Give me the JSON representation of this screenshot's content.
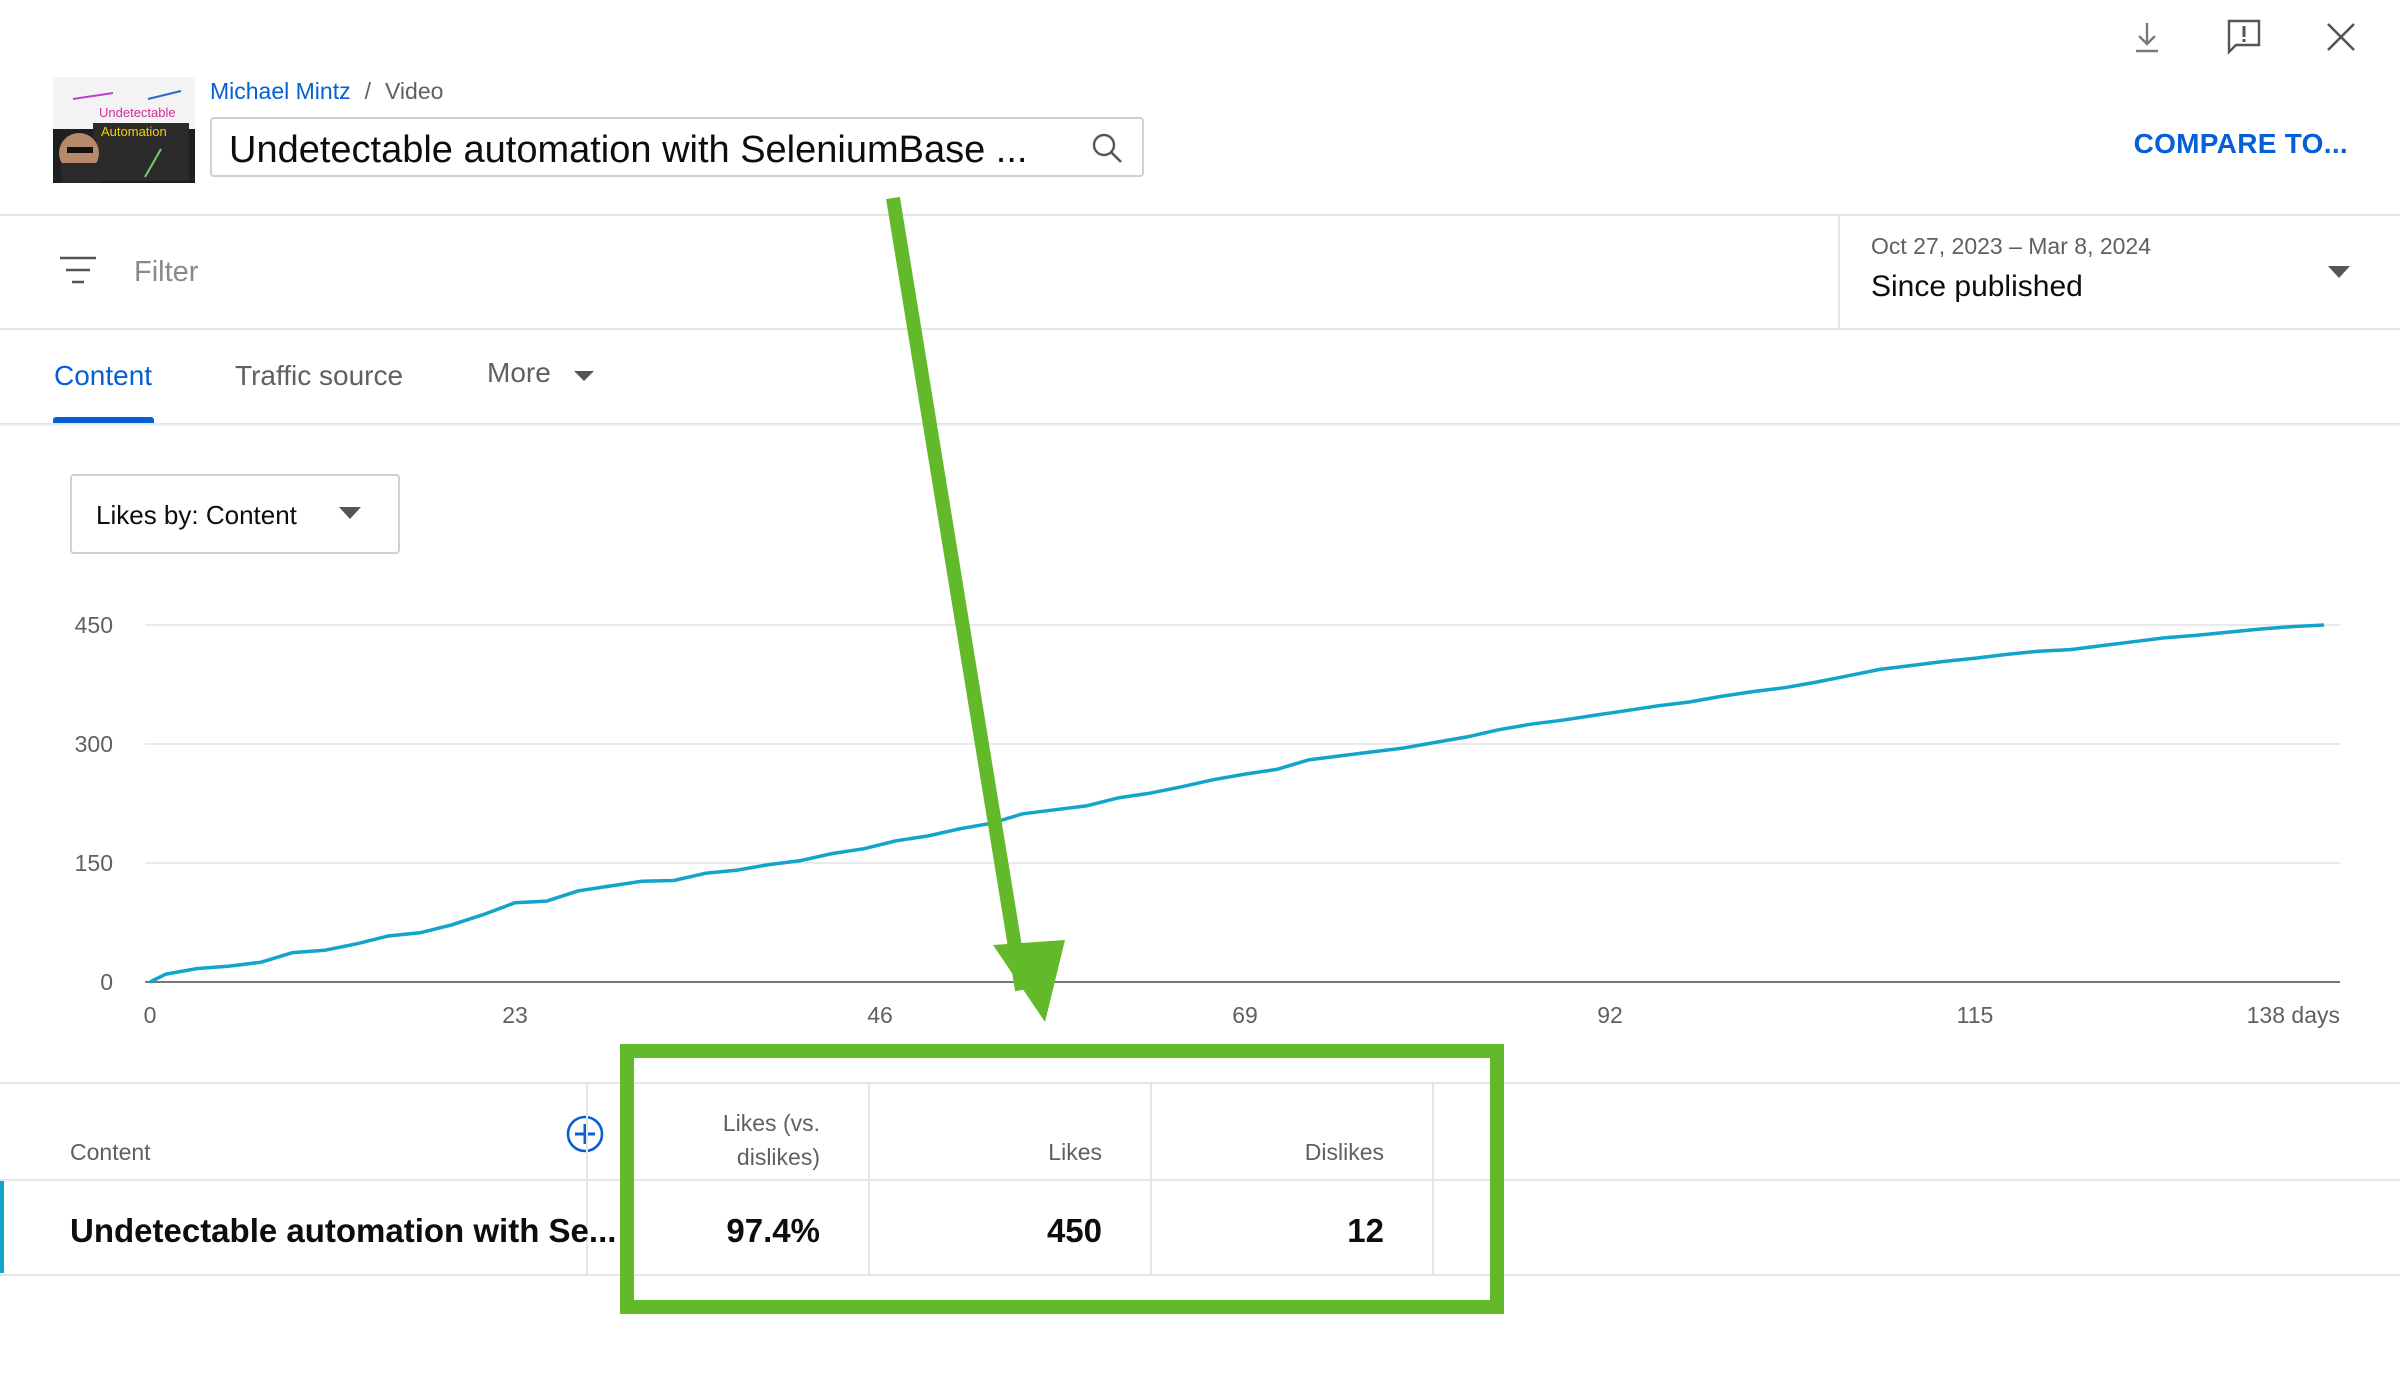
{
  "header": {
    "channel": "Michael Mintz",
    "separator": "/",
    "crumb_type": "Video",
    "title": "Undetectable automation with SeleniumBase ...",
    "compare_label": "COMPARE TO...",
    "thumbnail_text": "Undetectable Automation"
  },
  "toolbar": {
    "download_icon": "download-icon",
    "feedback_icon": "feedback-icon",
    "close_icon": "close-icon"
  },
  "filter": {
    "label": "Filter",
    "date_range": "Oct 27, 2023 – Mar 8, 2024",
    "period": "Since published"
  },
  "tabs": [
    {
      "label": "Content",
      "active": true
    },
    {
      "label": "Traffic source",
      "active": false
    },
    {
      "label": "More",
      "active": false
    }
  ],
  "metric_selector": {
    "label": "Likes by: Content"
  },
  "chart_data": {
    "type": "line",
    "title": "",
    "xlabel": "",
    "ylabel": "",
    "x_ticks": [
      "0",
      "23",
      "46",
      "69",
      "92",
      "115",
      "138 days"
    ],
    "y_ticks": [
      "0",
      "150",
      "300",
      "450"
    ],
    "xlim": [
      0,
      138
    ],
    "ylim": [
      0,
      450
    ],
    "grid": true,
    "series": [
      {
        "color": "#12a4c9",
        "x": [
          0,
          1,
          3,
          5,
          7,
          9,
          11,
          13,
          15,
          17,
          19,
          21,
          23,
          25,
          27,
          29,
          31,
          33,
          35,
          37,
          39,
          41,
          43,
          45,
          47,
          49,
          51,
          53,
          55,
          57,
          59,
          61,
          63,
          65,
          67,
          69,
          71,
          73,
          75,
          77,
          79,
          81,
          83,
          85,
          87,
          89,
          91,
          93,
          95,
          97,
          99,
          101,
          103,
          105,
          107,
          109,
          111,
          113,
          115,
          117,
          119,
          121,
          123,
          125,
          127,
          129,
          131,
          133,
          135,
          137
        ],
        "y": [
          0,
          10,
          17,
          20,
          25,
          37,
          40,
          48,
          58,
          62,
          72,
          85,
          100,
          102,
          115,
          121,
          127,
          128,
          137,
          141,
          148,
          153,
          162,
          168,
          178,
          184,
          193,
          200,
          212,
          217,
          222,
          232,
          238,
          246,
          255,
          262,
          268,
          280,
          285,
          290,
          295,
          302,
          309,
          318,
          325,
          330,
          336,
          342,
          348,
          353,
          360,
          366,
          371,
          378,
          386,
          394,
          399,
          404,
          408,
          413,
          417,
          419,
          424,
          429,
          434,
          437,
          441,
          445,
          448,
          450
        ]
      }
    ]
  },
  "table": {
    "headers": {
      "content": "Content",
      "ratio_line1": "Likes (vs.",
      "ratio_line2": "dislikes)",
      "likes": "Likes",
      "dislikes": "Dislikes"
    },
    "rows": [
      {
        "content": "Undetectable automation with Se...",
        "ratio": "97.4%",
        "likes": "450",
        "dislikes": "12"
      }
    ]
  },
  "colors": {
    "accent": "#065fd4",
    "line": "#12a4c9",
    "annotation": "#62ba2b"
  }
}
